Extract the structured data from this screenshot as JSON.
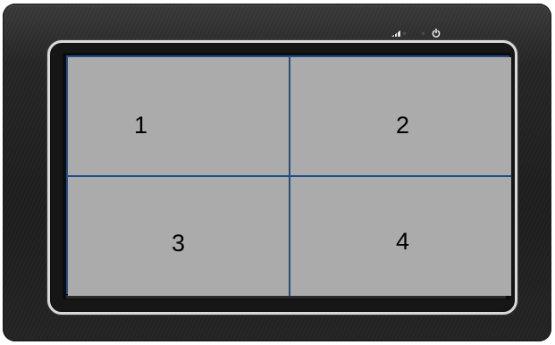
{
  "device": {
    "indicators": [
      {
        "icon": "signal-bars-icon"
      },
      {
        "icon": "status-led-icon"
      },
      {
        "icon": "status-led-icon"
      },
      {
        "icon": "power-icon"
      }
    ]
  },
  "screen": {
    "layout": "2x2 quad split",
    "divider_color": "#1f4f8a",
    "pane_color": "#ababab",
    "panes": [
      {
        "label": "1"
      },
      {
        "label": "2"
      },
      {
        "label": "3"
      },
      {
        "label": "4"
      }
    ]
  }
}
